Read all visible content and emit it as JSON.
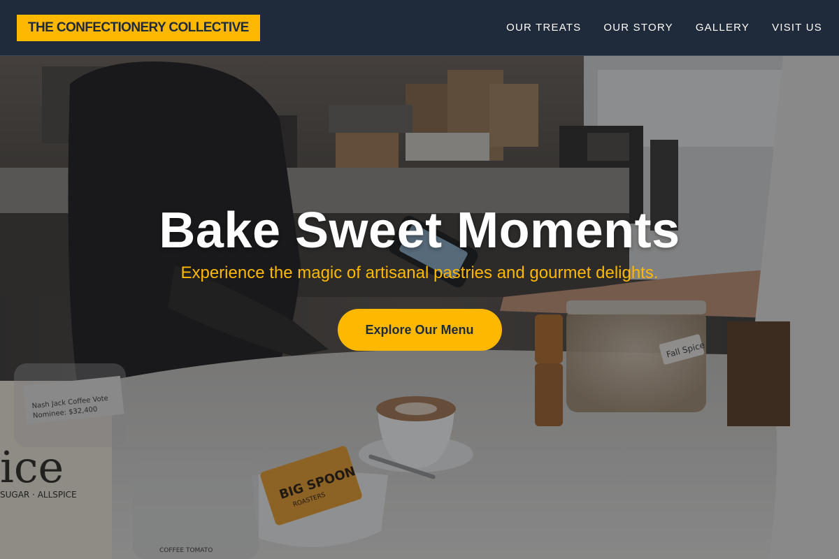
{
  "brand": {
    "name": "THE CONFECTIONERY COLLECTIVE",
    "accent": "#ffb800",
    "navy": "#1f2a3a"
  },
  "nav": {
    "items": [
      {
        "label": "OUR TREATS"
      },
      {
        "label": "OUR STORY"
      },
      {
        "label": "GALLERY"
      },
      {
        "label": "VISIT US"
      }
    ]
  },
  "hero": {
    "title": "Bake Sweet Moments",
    "subtitle": "Experience the magic of artisanal pastries and gourmet delights.",
    "cta_label": "Explore Our Menu"
  },
  "photo": {
    "label_card_lines": [
      "Nash Jack Coffee Vote",
      "Nominee: $32,400"
    ],
    "chalk_sign": "ice",
    "chalk_sign_small": "SUGAR · ALLSPICE",
    "jar_label": "Fall Spice",
    "bag_brand": "BIG SPOON",
    "bag_tagline": "ROASTERS",
    "pitcher_label": "COFFEE TOMATO"
  }
}
